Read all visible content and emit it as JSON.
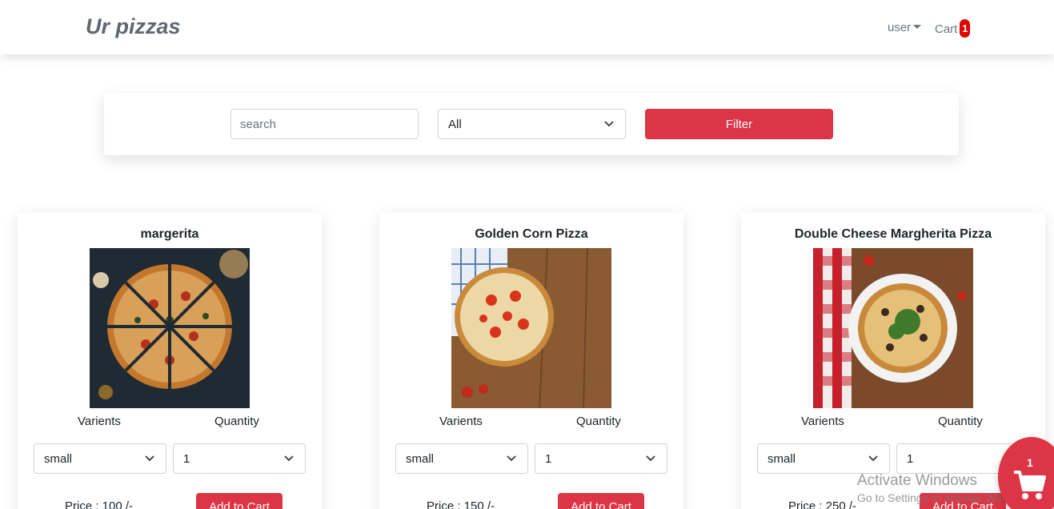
{
  "brand": "Ur pizzas",
  "nav": {
    "user_label": "user",
    "cart_label": "Cart",
    "cart_count": "1"
  },
  "filter": {
    "search_placeholder": "search",
    "category_value": "All",
    "button_label": "Filter"
  },
  "labels": {
    "varients": "Varients",
    "quantity": "Quantity",
    "add_to_cart": "Add to Cart"
  },
  "pizzas": [
    {
      "name": "margerita",
      "varient": "small",
      "quantity": "1",
      "price_text": "Price : 100 /-"
    },
    {
      "name": "Golden Corn Pizza",
      "varient": "small",
      "quantity": "1",
      "price_text": "Price : 150 /-"
    },
    {
      "name": "Double Cheese Margherita Pizza",
      "varient": "small",
      "quantity": "1",
      "price_text": "Price : 250 /-"
    }
  ],
  "floating_cart": {
    "count": "1"
  },
  "watermark": {
    "line1": "Activate Windows",
    "line2": "Go to Settings to activate Windows."
  },
  "colors": {
    "accent": "#dc3545",
    "badge": "#e00000",
    "brand_text": "#5f6670"
  }
}
